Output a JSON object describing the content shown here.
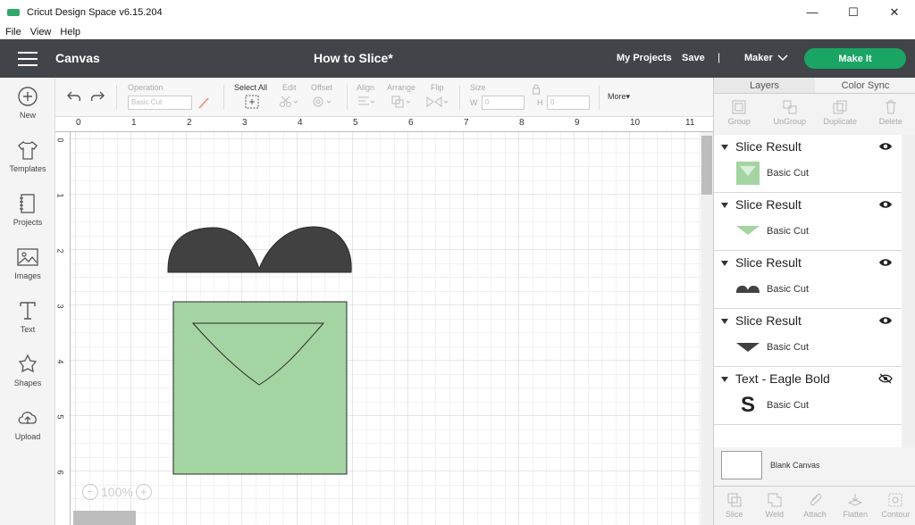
{
  "window": {
    "title": "Cricut Design Space  v6.15.204",
    "logo_text": "cricut",
    "controls": {
      "minimize": "—",
      "maximize": "☐",
      "close": "✕"
    }
  },
  "menu": [
    "File",
    "View",
    "Help"
  ],
  "header": {
    "section": "Canvas",
    "project_title": "How to Slice*",
    "my_projects": "My Projects",
    "save": "Save",
    "separator": "|",
    "machine": "Maker",
    "make_it": "Make It",
    "colors": {
      "bar": "#414449",
      "accent": "#1aa564"
    }
  },
  "left_tools": [
    {
      "label": "New",
      "icon": "plus-circle-icon"
    },
    {
      "label": "Templates",
      "icon": "tshirt-icon"
    },
    {
      "label": "Projects",
      "icon": "notebook-icon"
    },
    {
      "label": "Images",
      "icon": "image-icon"
    },
    {
      "label": "Text",
      "icon": "text-icon"
    },
    {
      "label": "Shapes",
      "icon": "shapes-icon"
    },
    {
      "label": "Upload",
      "icon": "upload-cloud-icon"
    }
  ],
  "edit_toolbar": {
    "operation_label": "Operation",
    "operation_value": "Basic Cut",
    "select_all": "Select All",
    "edit": "Edit",
    "offset": "Offset",
    "align": "Align",
    "arrange": "Arrange",
    "flip": "Flip",
    "size": "Size",
    "w_label": "W",
    "w_value": "0",
    "h_label": "H",
    "h_value": "0",
    "more": "More▾"
  },
  "canvas": {
    "ruler_top": [
      "0",
      "1",
      "2",
      "3",
      "4",
      "5",
      "6",
      "7",
      "8",
      "9",
      "10",
      "11"
    ],
    "ruler_left": [
      "0",
      "1",
      "2",
      "3",
      "4",
      "5",
      "6"
    ],
    "zoom_minus": "−",
    "zoom_value": "100%",
    "zoom_plus": "+",
    "colors": {
      "dark_shape": "#414141",
      "green_shape": "#a4d4a2"
    }
  },
  "right_panel": {
    "tabs": [
      "Layers",
      "Color Sync"
    ],
    "actions": [
      "Group",
      "UnGroup",
      "Duplicate",
      "Delete"
    ],
    "layers": [
      {
        "name": "Slice Result",
        "sub": "Basic Cut",
        "thumb": "green-square-triangle",
        "visible": true
      },
      {
        "name": "Slice Result",
        "sub": "Basic Cut",
        "thumb": "green-triangle",
        "visible": true
      },
      {
        "name": "Slice Result",
        "sub": "Basic Cut",
        "thumb": "dark-arches",
        "visible": true
      },
      {
        "name": "Slice Result",
        "sub": "Basic Cut",
        "thumb": "dark-triangle",
        "visible": true
      },
      {
        "name": "Text - Eagle Bold",
        "sub": "Basic Cut",
        "thumb": "s-glyph",
        "visible": false
      }
    ],
    "thumb_glyph": "S",
    "blank_canvas": "Blank Canvas",
    "bottom_actions": [
      "Slice",
      "Weld",
      "Attach",
      "Flatten",
      "Contour"
    ]
  }
}
